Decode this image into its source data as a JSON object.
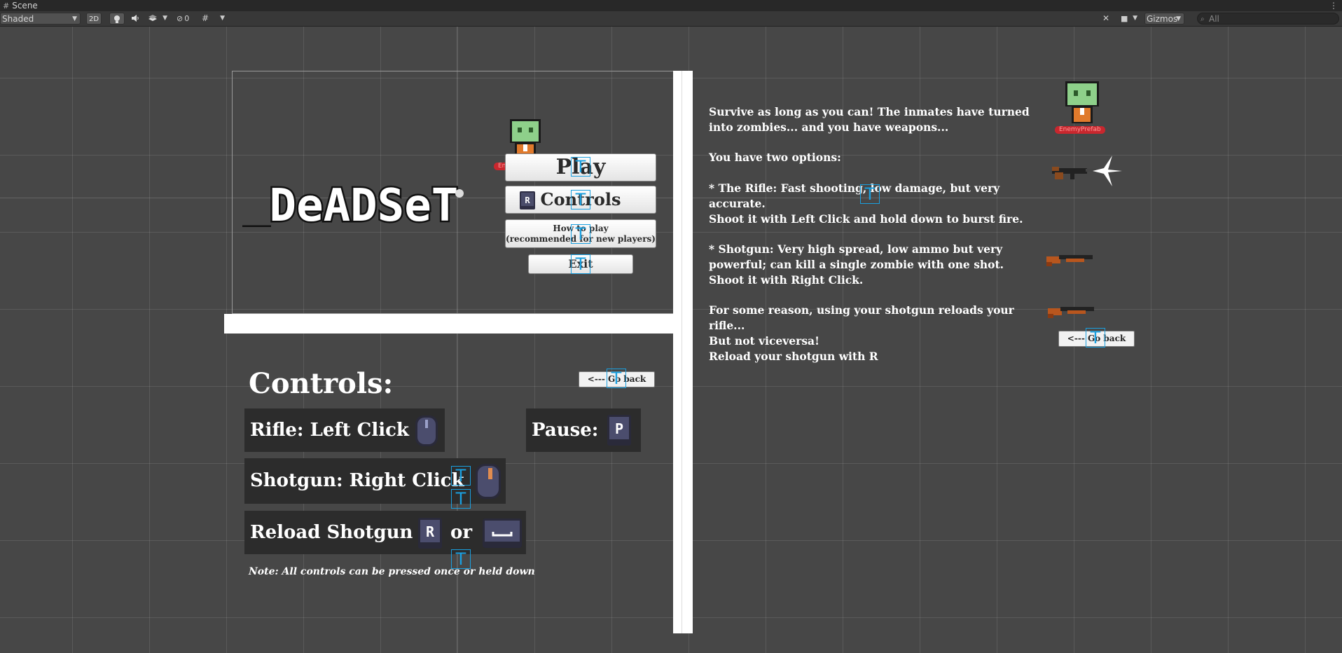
{
  "editor": {
    "window_tab": "Scene",
    "draw_mode": "Shaded",
    "mode_2d": "2D",
    "hidden_count": "0",
    "gizmos_label": "Gizmos",
    "search_placeholder": "All"
  },
  "game": {
    "logo_text": "_DeADSeT",
    "menu": {
      "play": "Play",
      "controls": "Controls",
      "howto_line1": "How to play",
      "howto_line2": "(recommended for new players)",
      "exit": "Exit"
    },
    "enemy_label_1": "EnemyPrefab (1)",
    "enemy_label_2": "EnemyPrefab",
    "go_back": "<--- Go back",
    "controls": {
      "title": "Controls:",
      "rifle": "Rifle: Left Click",
      "pause": "Pause:",
      "shotgun": "Shotgun: Right Click",
      "reload": "Reload Shotgun",
      "or": "or",
      "note": "Note: All controls can be pressed once or held down",
      "key_r": "R",
      "key_p": "P"
    },
    "howto": {
      "p1_l1": "Survive as long as you can! The inmates have turned",
      "p1_l2": "into zombies... and you have weapons...",
      "p2": "You have two options:",
      "p3_l1": "* The Rifle: Fast shooting, low damage, but very",
      "p3_l2": "accurate.",
      "p3_l3": "Shoot it with Left Click and hold down to burst fire.",
      "p4_l1": "* Shotgun: Very high spread, low ammo but very",
      "p4_l2": "powerful; can kill a single zombie with one shot.",
      "p4_l3": "Shoot it with Right Click.",
      "p5_l1": "For some reason, using your shotgun reloads your rifle...",
      "p5_l2": "But not viceversa!",
      "p5_l3": "Reload your shotgun with R"
    }
  }
}
